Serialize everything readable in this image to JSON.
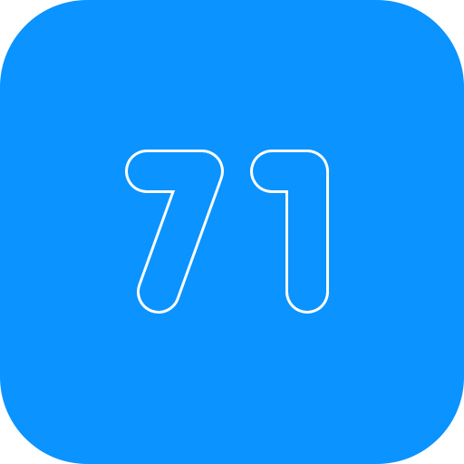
{
  "icon": {
    "number": "71",
    "background_color": "#0b93ff",
    "stroke_color": "#ffffff"
  }
}
